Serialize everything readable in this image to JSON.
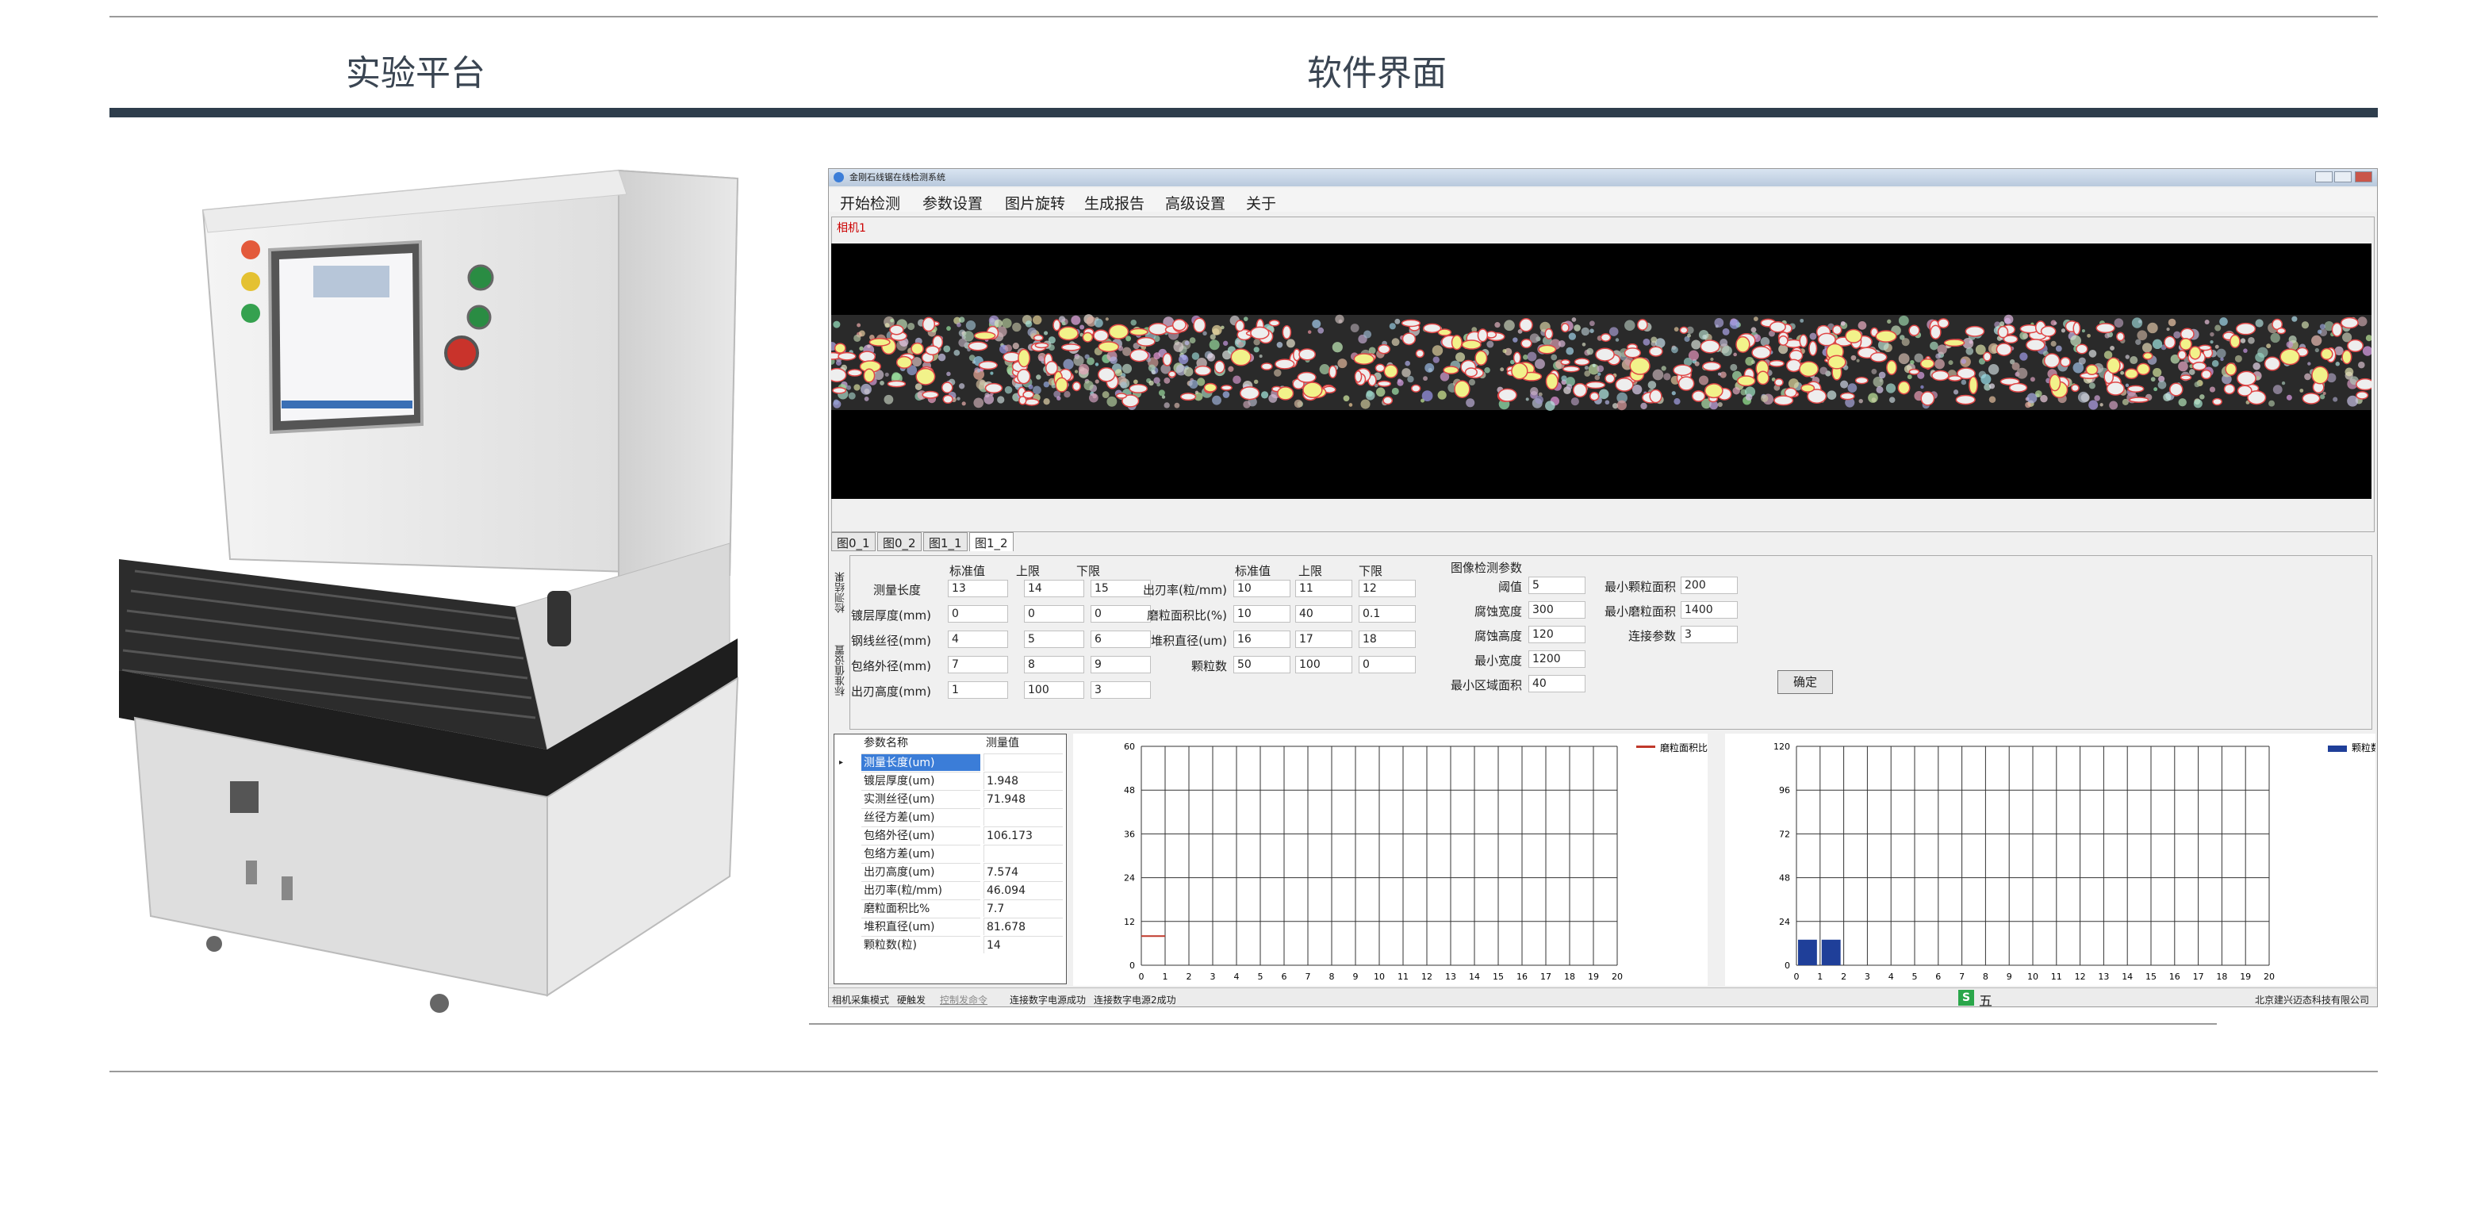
{
  "headers": {
    "left": "实验平台",
    "right": "软件界面"
  },
  "window": {
    "title": "金刚石线锯在线检测系统"
  },
  "menu": [
    "开始检测",
    "参数设置",
    "图片旋转",
    "生成报告",
    "高级设置",
    "关于"
  ],
  "camera_label": "相机1",
  "image_tabs": [
    "图0_1",
    "图0_2",
    "图1_1",
    "图1_2"
  ],
  "side_tabs": [
    "检测结果",
    "标准值设置"
  ],
  "standard_params": {
    "col_headers": [
      "标准值",
      "上限",
      "下限"
    ],
    "rows": [
      {
        "label": "测量长度",
        "values": [
          "13",
          "14",
          "15"
        ]
      },
      {
        "label": "镀层厚度(mm)",
        "values": [
          "0",
          "0",
          "0"
        ]
      },
      {
        "label": "钢线丝径(mm)",
        "values": [
          "4",
          "5",
          "6"
        ]
      },
      {
        "label": "包络外径(mm)",
        "values": [
          "7",
          "8",
          "9"
        ]
      },
      {
        "label": "出刃高度(mm)",
        "values": [
          "1",
          "100",
          "3"
        ]
      }
    ]
  },
  "grain_params": {
    "col_headers": [
      "标准值",
      "上限",
      "下限"
    ],
    "rows": [
      {
        "label": "出刃率(粒/mm)",
        "values": [
          "10",
          "11",
          "12"
        ]
      },
      {
        "label": "磨粒面积比(%)",
        "values": [
          "10",
          "40",
          "0.1"
        ]
      },
      {
        "label": "堆积直径(um)",
        "values": [
          "16",
          "17",
          "18"
        ]
      },
      {
        "label": "颗粒数",
        "values": [
          "50",
          "100",
          "0"
        ]
      }
    ]
  },
  "image_params": {
    "title": "图像检测参数",
    "left": [
      {
        "label": "阈值",
        "value": "5"
      },
      {
        "label": "腐蚀宽度",
        "value": "300"
      },
      {
        "label": "腐蚀高度",
        "value": "120"
      },
      {
        "label": "最小宽度",
        "value": "1200"
      },
      {
        "label": "最小区域面积",
        "value": "40"
      }
    ],
    "right": [
      {
        "label": "最小颗粒面积",
        "value": "200"
      },
      {
        "label": "最小磨粒面积",
        "value": "1400"
      },
      {
        "label": "连接参数",
        "value": "3"
      }
    ],
    "ok_label": "确定"
  },
  "results": {
    "headers": [
      "参数名称",
      "测量值"
    ],
    "rows": [
      {
        "name": "测量长度(um)",
        "value": ""
      },
      {
        "name": "镀层厚度(um)",
        "value": "1.948"
      },
      {
        "name": "实测丝径(um)",
        "value": "71.948"
      },
      {
        "name": "丝径方差(um)",
        "value": ""
      },
      {
        "name": "包络外径(um)",
        "value": "106.173"
      },
      {
        "name": "包络方差(um)",
        "value": ""
      },
      {
        "name": "出刃高度(um)",
        "value": "7.574"
      },
      {
        "name": "出刃率(粒/mm)",
        "value": "46.094"
      },
      {
        "name": "磨粒面积比%",
        "value": "7.7"
      },
      {
        "name": "堆积直径(um)",
        "value": "81.678"
      },
      {
        "name": "颗粒数(粒)",
        "value": "14"
      }
    ]
  },
  "chart_data": [
    {
      "type": "line",
      "legend": "磨粒面积比",
      "color": "#c0392b",
      "xlim": [
        0,
        20
      ],
      "ylim": [
        0,
        60
      ],
      "yticks": [
        0,
        12,
        24,
        36,
        48,
        60
      ],
      "xticks": [
        0,
        1,
        2,
        3,
        4,
        5,
        6,
        7,
        8,
        9,
        10,
        11,
        12,
        13,
        14,
        15,
        16,
        17,
        18,
        19,
        20
      ],
      "x": [
        0,
        1
      ],
      "values": [
        8,
        8
      ]
    },
    {
      "type": "bar",
      "legend": "颗粒数",
      "color": "#1f3f99",
      "xlim": [
        0,
        20
      ],
      "ylim": [
        0,
        120
      ],
      "yticks": [
        0,
        24,
        48,
        72,
        96,
        120
      ],
      "xticks": [
        0,
        1,
        2,
        3,
        4,
        5,
        6,
        7,
        8,
        9,
        10,
        11,
        12,
        13,
        14,
        15,
        16,
        17,
        18,
        19,
        20
      ],
      "x": [
        0,
        1
      ],
      "values": [
        14,
        14
      ]
    }
  ],
  "status": {
    "mode": "相机采集模式",
    "trigger": "硬触发",
    "ctrl": "控制发命令",
    "conn1": "连接数字电源成功",
    "conn2": "连接数字电源2成功",
    "ime": "五",
    "company": "北京建兴迈态科技有限公司"
  }
}
